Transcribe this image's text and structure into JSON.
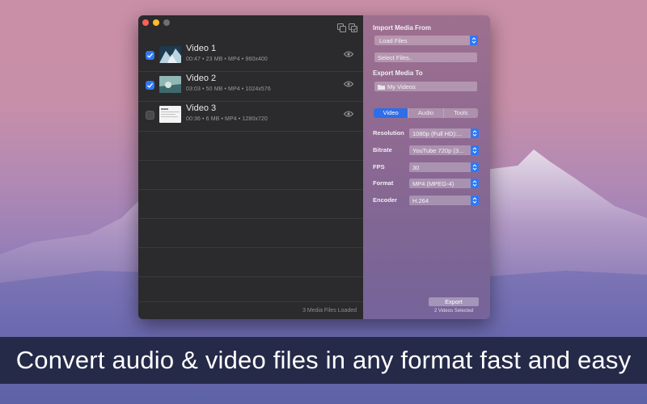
{
  "window": {
    "status_text": "3 Media Files Loaded"
  },
  "videos": [
    {
      "title": "Video 1",
      "meta": "00:47 • 23 MB • MP4 • 960x400",
      "checked": true
    },
    {
      "title": "Video 2",
      "meta": "03:03 • 50 MB • MP4 • 1024x576",
      "checked": true
    },
    {
      "title": "Video 3",
      "meta": "00:36 • 6 MB • MP4 • 1280x720",
      "checked": false
    }
  ],
  "import": {
    "label": "Import Media From",
    "source_value": "Load Files",
    "select_button": "Select Files.."
  },
  "export_to": {
    "label": "Export Media To",
    "folder": "My Videos"
  },
  "tabs": [
    {
      "label": "Video",
      "active": true
    },
    {
      "label": "Audio",
      "active": false
    },
    {
      "label": "Tools",
      "active": false
    }
  ],
  "settings": [
    {
      "label": "Resolution",
      "value": "1080p (Full HD):..."
    },
    {
      "label": "Bitrate",
      "value": "YouTube 720p (3..."
    },
    {
      "label": "FPS",
      "value": "30"
    },
    {
      "label": "Format",
      "value": "MP4 (MPEG-4)"
    },
    {
      "label": "Encoder",
      "value": "H.264"
    }
  ],
  "export": {
    "button": "Export",
    "selected_text": "2 Videos Selected"
  },
  "banner": {
    "text": "Convert audio & video files in any format fast and easy"
  },
  "colors": {
    "accent": "#2e78f6",
    "banner_bg": "#262a49",
    "left_pane": "#2b2a2c"
  },
  "icons": [
    "window-duplicate-icon",
    "window-stack-icon",
    "checkbox-icon",
    "eye-icon",
    "folder-icon",
    "up-down-chevron-icon"
  ]
}
